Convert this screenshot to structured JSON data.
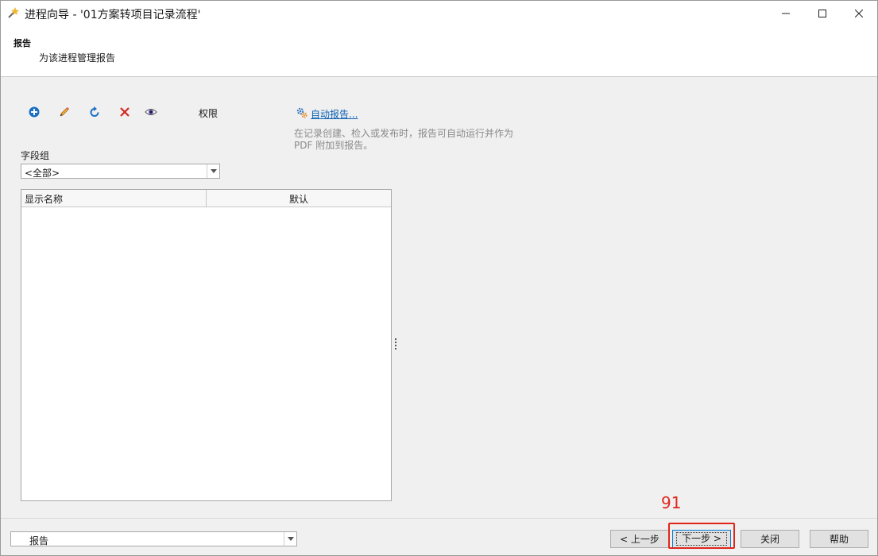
{
  "window": {
    "title": "进程向导 - '01方案转项目记录流程'"
  },
  "header": {
    "title": "报告",
    "subtitle": "为该进程管理报告"
  },
  "toolbar": {
    "icons": [
      "add-icon",
      "edit-icon",
      "refresh-icon",
      "delete-icon",
      "view-icon"
    ],
    "permissions_label": "权限",
    "auto_report_link": "自动报告...",
    "auto_report_desc": "在记录创建、检入或发布时，报告可自动运行并作为 PDF 附加到报告。"
  },
  "field_group": {
    "label": "字段组",
    "value": "<全部>"
  },
  "grid": {
    "columns": [
      "显示名称",
      "默认"
    ],
    "rows": []
  },
  "footer": {
    "step_select": "报告",
    "prev": "< 上一步",
    "next": "下一步 >",
    "close": "关闭",
    "help": "帮助"
  },
  "annotation": {
    "number": "91"
  },
  "colors": {
    "accent": "#0078d7",
    "link": "#0b5fb5",
    "annotation": "#e0261b"
  }
}
